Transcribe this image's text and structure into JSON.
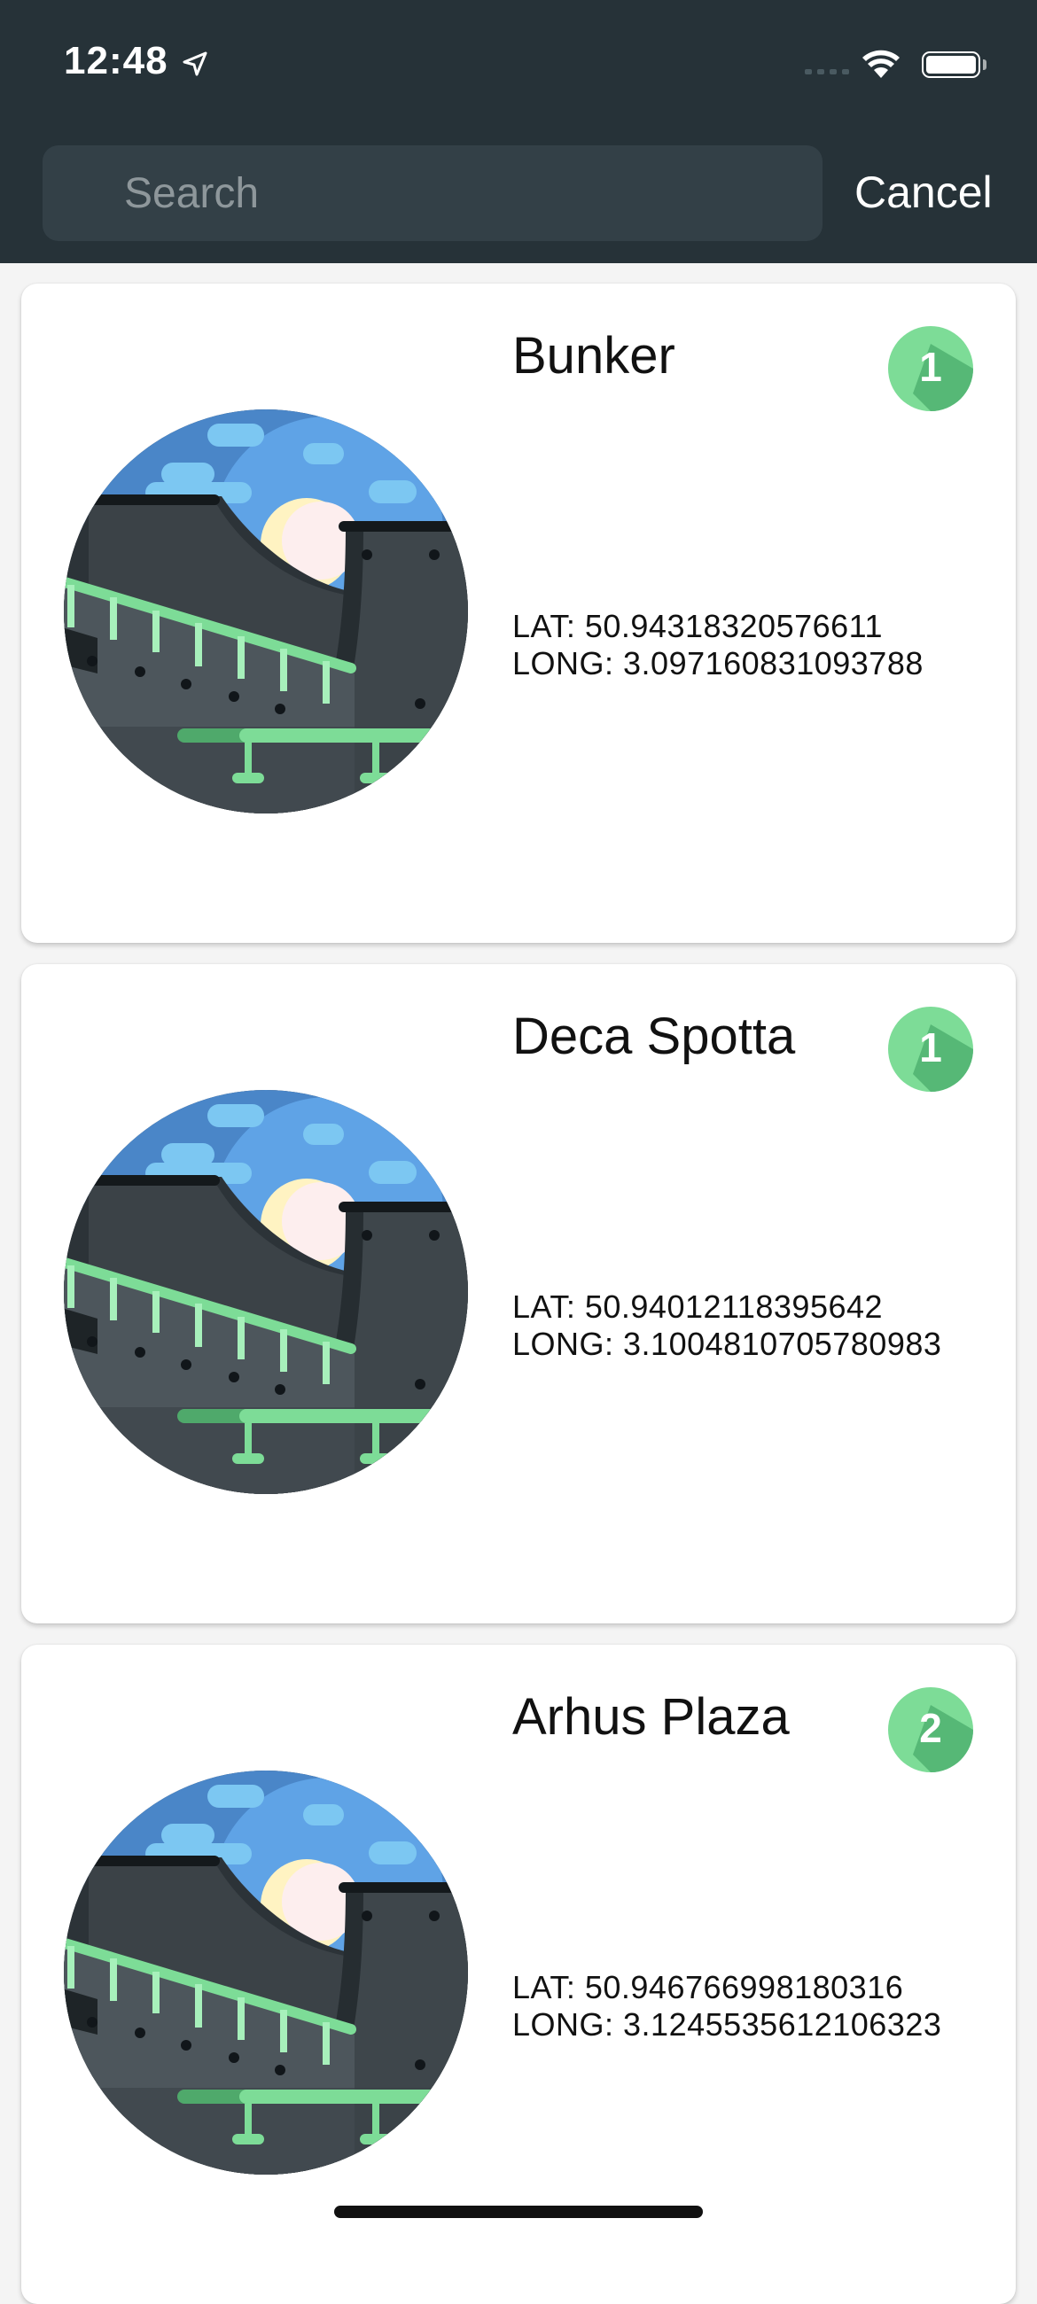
{
  "status_bar": {
    "time": "12:48"
  },
  "search": {
    "placeholder": "Search",
    "value": "",
    "cancel_label": "Cancel"
  },
  "spots": [
    {
      "name": "Bunker",
      "badge": "1",
      "lat_label": "LAT: 50.94318320576611",
      "long_label": "LONG: 3.097160831093788",
      "image_icon": "skate-bowl-illustration"
    },
    {
      "name": "Deca Spotta",
      "badge": "1",
      "lat_label": "LAT: 50.94012118395642",
      "long_label": "LONG: 3.1004810705780983",
      "image_icon": "skate-bowl-illustration"
    },
    {
      "name": "Arhus Plaza",
      "badge": "2",
      "lat_label": "LAT: 50.946766998180316",
      "long_label": "LONG: 3.1245535612106323",
      "image_icon": "skate-bowl-illustration"
    }
  ],
  "colors": {
    "header_bg": "#263238",
    "search_bg": "#334047",
    "badge_green": "#7ddc97",
    "badge_shadow": "#56b876",
    "page_bg": "#f4f4f4"
  }
}
